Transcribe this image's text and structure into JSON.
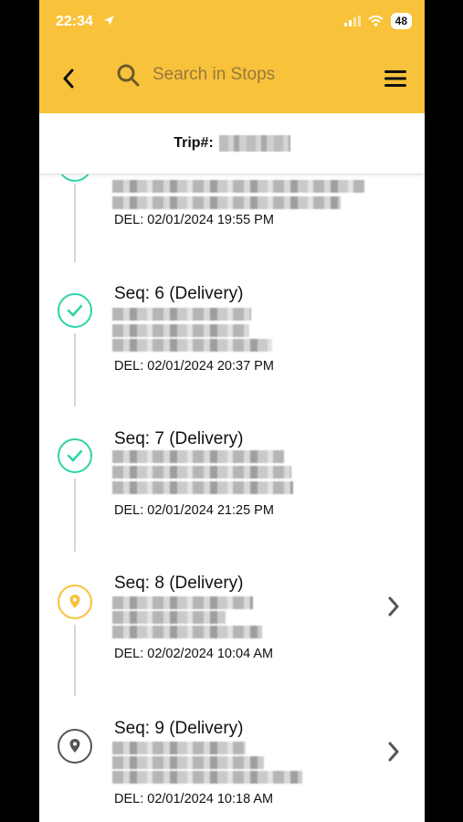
{
  "status_bar": {
    "time": "22:34",
    "battery": "48"
  },
  "search": {
    "placeholder": "Search in Stops"
  },
  "trip": {
    "label": "Trip#:"
  },
  "stops": [
    {
      "seq": "",
      "del": "DEL: 02/01/2024 19:55 PM",
      "status": "done"
    },
    {
      "seq": "Seq:  6 (Delivery)",
      "del": "DEL: 02/01/2024 20:37 PM",
      "status": "done"
    },
    {
      "seq": "Seq:  7 (Delivery)",
      "del": "DEL: 02/01/2024 21:25 PM",
      "status": "done"
    },
    {
      "seq": "Seq:  8 (Delivery)",
      "del": "DEL: 02/02/2024 10:04 AM",
      "status": "pending"
    },
    {
      "seq": "Seq:  9 (Delivery)",
      "del": "DEL: 02/01/2024 10:18 AM",
      "status": "default"
    }
  ],
  "colors": {
    "header": "#F8C23A",
    "done": "#2DD4A8",
    "pending": "#F8C23A",
    "default": "#555555"
  }
}
